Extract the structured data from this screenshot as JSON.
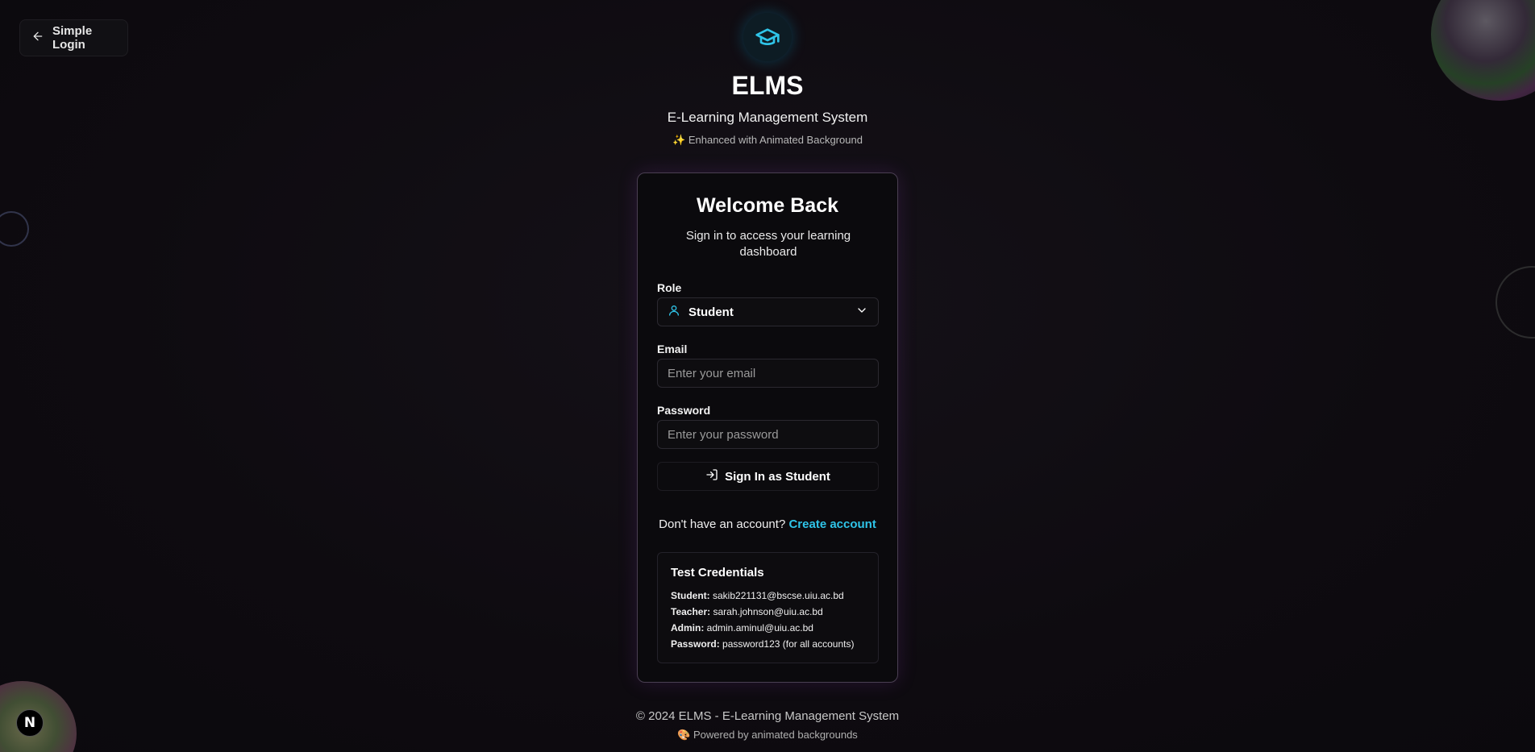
{
  "back_button": {
    "label": "Simple Login"
  },
  "header": {
    "title": "ELMS",
    "subtitle": "E-Learning Management System",
    "tagline": "✨ Enhanced with Animated Background"
  },
  "card": {
    "title": "Welcome Back",
    "subtitle": "Sign in to access your learning dashboard",
    "role": {
      "label": "Role",
      "value": "Student"
    },
    "email": {
      "label": "Email",
      "placeholder": "Enter your email",
      "value": ""
    },
    "password": {
      "label": "Password",
      "placeholder": "Enter your password",
      "value": ""
    },
    "signin_label": "Sign In as Student",
    "signup_prompt": "Don't have an account?",
    "signup_link": "Create account",
    "credentials": {
      "title": "Test Credentials",
      "rows": [
        {
          "key": "Student:",
          "value": "sakib221131@bscse.uiu.ac.bd"
        },
        {
          "key": "Teacher:",
          "value": "sarah.johnson@uiu.ac.bd"
        },
        {
          "key": "Admin:",
          "value": "admin.aminul@uiu.ac.bd"
        },
        {
          "key": "Password:",
          "value": "password123 (for all accounts)"
        }
      ]
    }
  },
  "footer": {
    "copyright": "© 2024 ELMS - E-Learning Management System",
    "powered": "🎨 Powered by animated backgrounds"
  },
  "dev_badge": {
    "label": "N"
  },
  "colors": {
    "accent": "#2fc4e8",
    "card_border": "#4a3f52",
    "background": "#0f0c12"
  }
}
